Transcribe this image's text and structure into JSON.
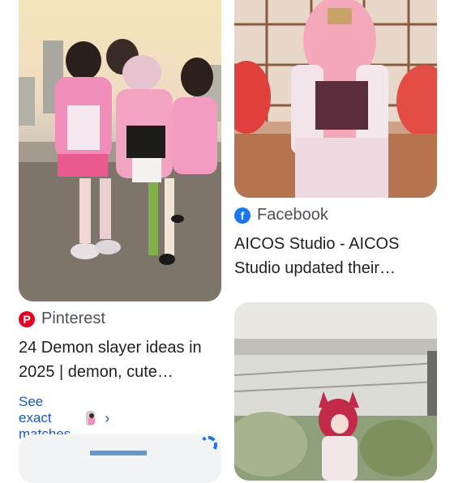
{
  "left_column": {
    "card1": {
      "image_alt": "Group of Demon Slayer cosplayers in pink kimonos",
      "source_name": "Pinterest",
      "source_icon": "pinterest-icon",
      "title": "24 Demon slayer ideas in 2025 | demon, cute…",
      "matches_label": "See exact matches"
    },
    "card2": {
      "image_alt": "Partially visible result thumbnail",
      "source_icon": "loading-spinner-icon"
    }
  },
  "right_column": {
    "card1": {
      "image_alt": "Cosplayer with long pink hair in kimono with red umbrellas",
      "source_name": "Facebook",
      "source_icon": "facebook-icon",
      "title": "AICOS Studio - AICOS Studio updated their…"
    },
    "card2": {
      "image_alt": "Cosplayer with red hair near white gazebo"
    }
  },
  "colors": {
    "pinterest": "#e60023",
    "facebook": "#1877f2",
    "link_blue": "#1a57b8",
    "source_gray": "#4d5156"
  }
}
